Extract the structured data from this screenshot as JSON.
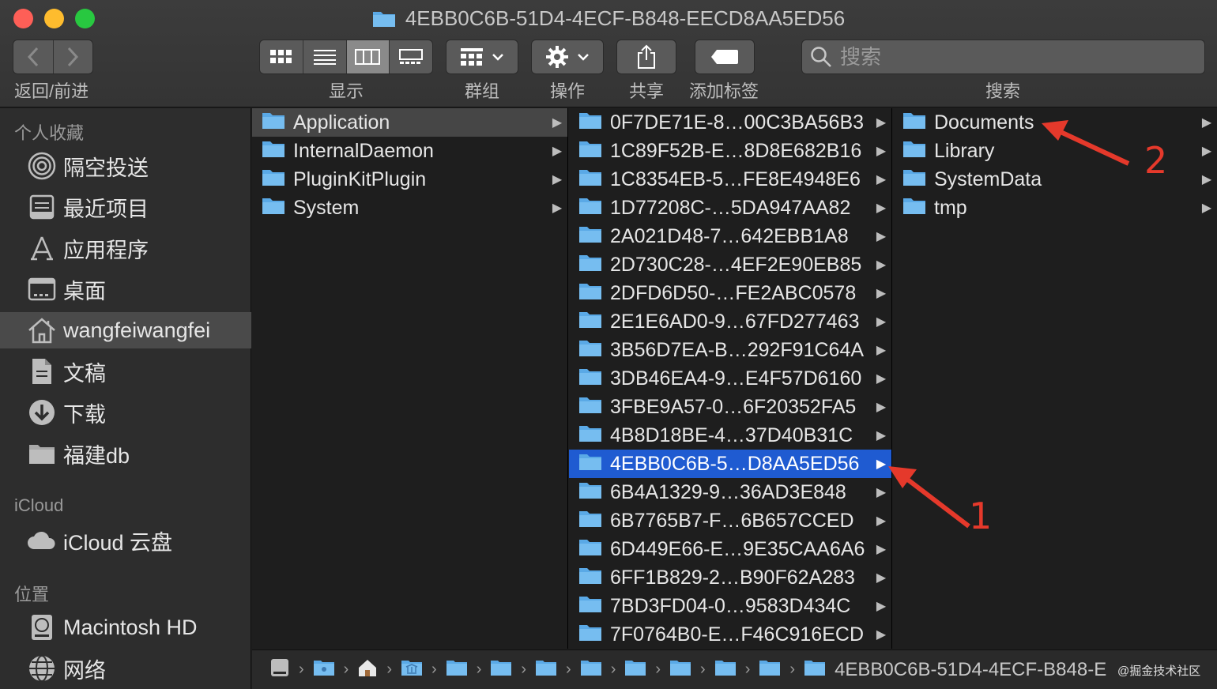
{
  "window": {
    "title": "4EBB0C6B-51D4-4ECF-B848-EECD8AA5ED56"
  },
  "toolbar": {
    "nav_label": "返回/前进",
    "view_label": "显示",
    "group_label": "群组",
    "action_label": "操作",
    "share_label": "共享",
    "tag_label": "添加标签",
    "search_label": "搜索",
    "search_placeholder": "搜索"
  },
  "sidebar": {
    "favorites_heading": "个人收藏",
    "favorites": [
      {
        "label": "隔空投送",
        "icon": "airdrop-icon"
      },
      {
        "label": "最近项目",
        "icon": "recents-icon"
      },
      {
        "label": "应用程序",
        "icon": "applications-icon"
      },
      {
        "label": "桌面",
        "icon": "desktop-icon"
      },
      {
        "label": "wangfeiwangfei",
        "icon": "home-icon",
        "selected": true
      },
      {
        "label": "文稿",
        "icon": "documents-icon"
      },
      {
        "label": "下载",
        "icon": "downloads-icon"
      },
      {
        "label": "福建db",
        "icon": "folder-icon"
      }
    ],
    "icloud_heading": "iCloud",
    "icloud": [
      {
        "label": "iCloud 云盘",
        "icon": "cloud-icon"
      }
    ],
    "locations_heading": "位置",
    "locations": [
      {
        "label": "Macintosh HD",
        "icon": "harddisk-icon"
      },
      {
        "label": "网络",
        "icon": "network-icon"
      }
    ]
  },
  "columns": {
    "col1": [
      "Application",
      "InternalDaemon",
      "PluginKitPlugin",
      "System"
    ],
    "col2": [
      "0F7DE71E-8…00C3BA56B3",
      "1C89F52B-E…8D8E682B16",
      "1C8354EB-5…FE8E4948E6",
      "1D77208C-…5DA947AA82",
      "2A021D48-7…642EBB1A8",
      "2D730C28-…4EF2E90EB85",
      "2DFD6D50-…FE2ABC0578",
      "2E1E6AD0-9…67FD277463",
      "3B56D7EA-B…292F91C64A",
      "3DB46EA4-9…E4F57D6160",
      "3FBE9A57-0…6F20352FA5",
      "4B8D18BE-4…37D40B31C",
      "4EBB0C6B-5…D8AA5ED56",
      "6B4A1329-9…36AD3E848",
      "6B7765B7-F…6B657CCED",
      "6D449E66-E…9E35CAA6A6",
      "6FF1B829-2…B90F62A283",
      "7BD3FD04-0…9583D434C",
      "7F0764B0-E…F46C916ECD"
    ],
    "col3": [
      "Documents",
      "Library",
      "SystemData",
      "tmp"
    ]
  },
  "pathbar": {
    "last": "4EBB0C6B-51D4-4ECF-B848-E"
  },
  "annotations": {
    "one": "1",
    "two": "2",
    "color": "#e5392b"
  },
  "watermark": "@掘金技术社区",
  "colors": {
    "selection_blue": "#1f5bd1",
    "folder_blue": "#5aa9e6"
  }
}
